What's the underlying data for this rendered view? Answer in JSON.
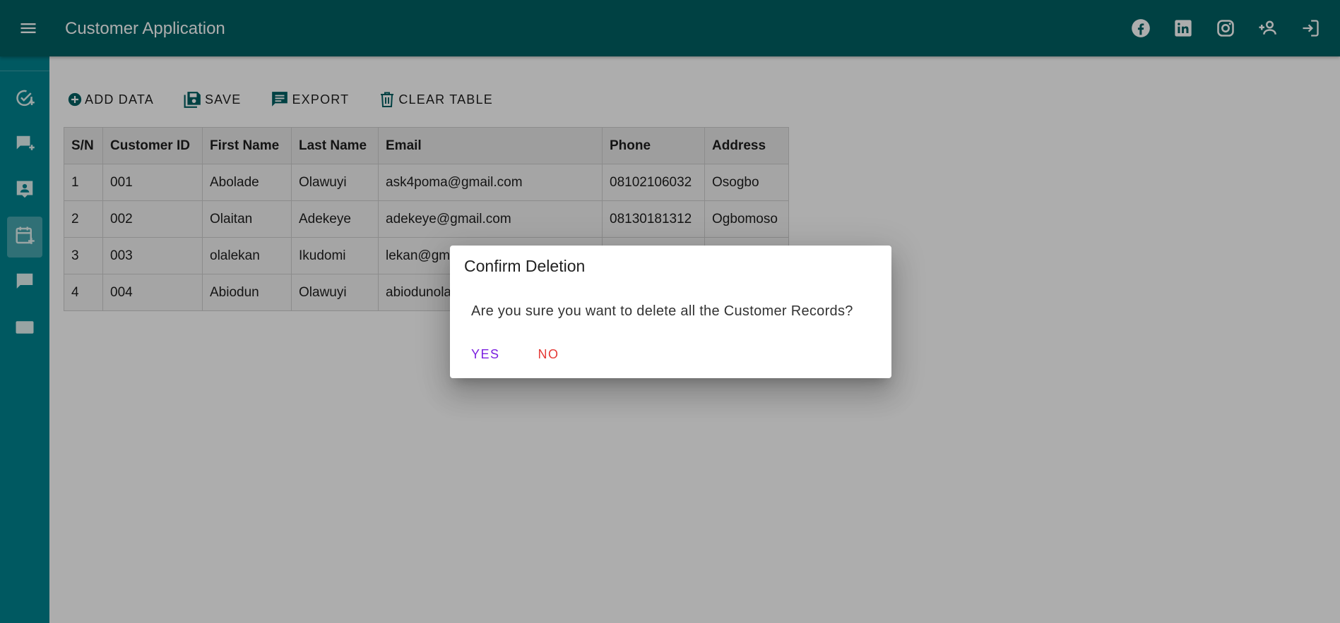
{
  "app": {
    "title": "Customer Application"
  },
  "toolbar": {
    "add_label": "ADD DATA",
    "save_label": "SAVE",
    "export_label": "EXPORT",
    "clear_label": "CLEAR TABLE"
  },
  "table": {
    "headers": [
      "S/N",
      "Customer ID",
      "First Name",
      "Last Name",
      "Email",
      "Phone",
      "Address"
    ],
    "rows": [
      [
        "1",
        "001",
        "Abolade",
        "Olawuyi",
        "ask4poma@gmail.com",
        "08102106032",
        "Osogbo"
      ],
      [
        "2",
        "002",
        "Olaitan",
        "Adekeye",
        "adekeye@gmail.com",
        "08130181312",
        "Ogbomoso"
      ],
      [
        "3",
        "003",
        "olalekan",
        "Ikudomi",
        "lekan@gm",
        "",
        ""
      ],
      [
        "4",
        "004",
        "Abiodun",
        "Olawuyi",
        "abiodunola",
        "",
        ""
      ]
    ]
  },
  "dialog": {
    "title": "Confirm Deletion",
    "message": "Are you sure you want to delete all the Customer Records?",
    "yes_label": "YES",
    "no_label": "NO"
  },
  "colors": {
    "appbar": "#006064",
    "sidebar": "#00838f",
    "icon_accent": "#006064",
    "yes": "#7b1fe0",
    "no": "#e53935"
  },
  "icons": {
    "appbar": [
      "menu-icon",
      "facebook-icon",
      "linkedin-icon",
      "instagram-icon",
      "add-user-icon",
      "login-icon"
    ],
    "sidebar": [
      "check-circle-icon",
      "add-comment-icon",
      "contact-card-icon",
      "calendar-add-icon",
      "chat-icon",
      "tablet-icon"
    ],
    "toolbar": [
      "add-circle-icon",
      "save-icon",
      "export-icon",
      "delete-icon"
    ]
  }
}
